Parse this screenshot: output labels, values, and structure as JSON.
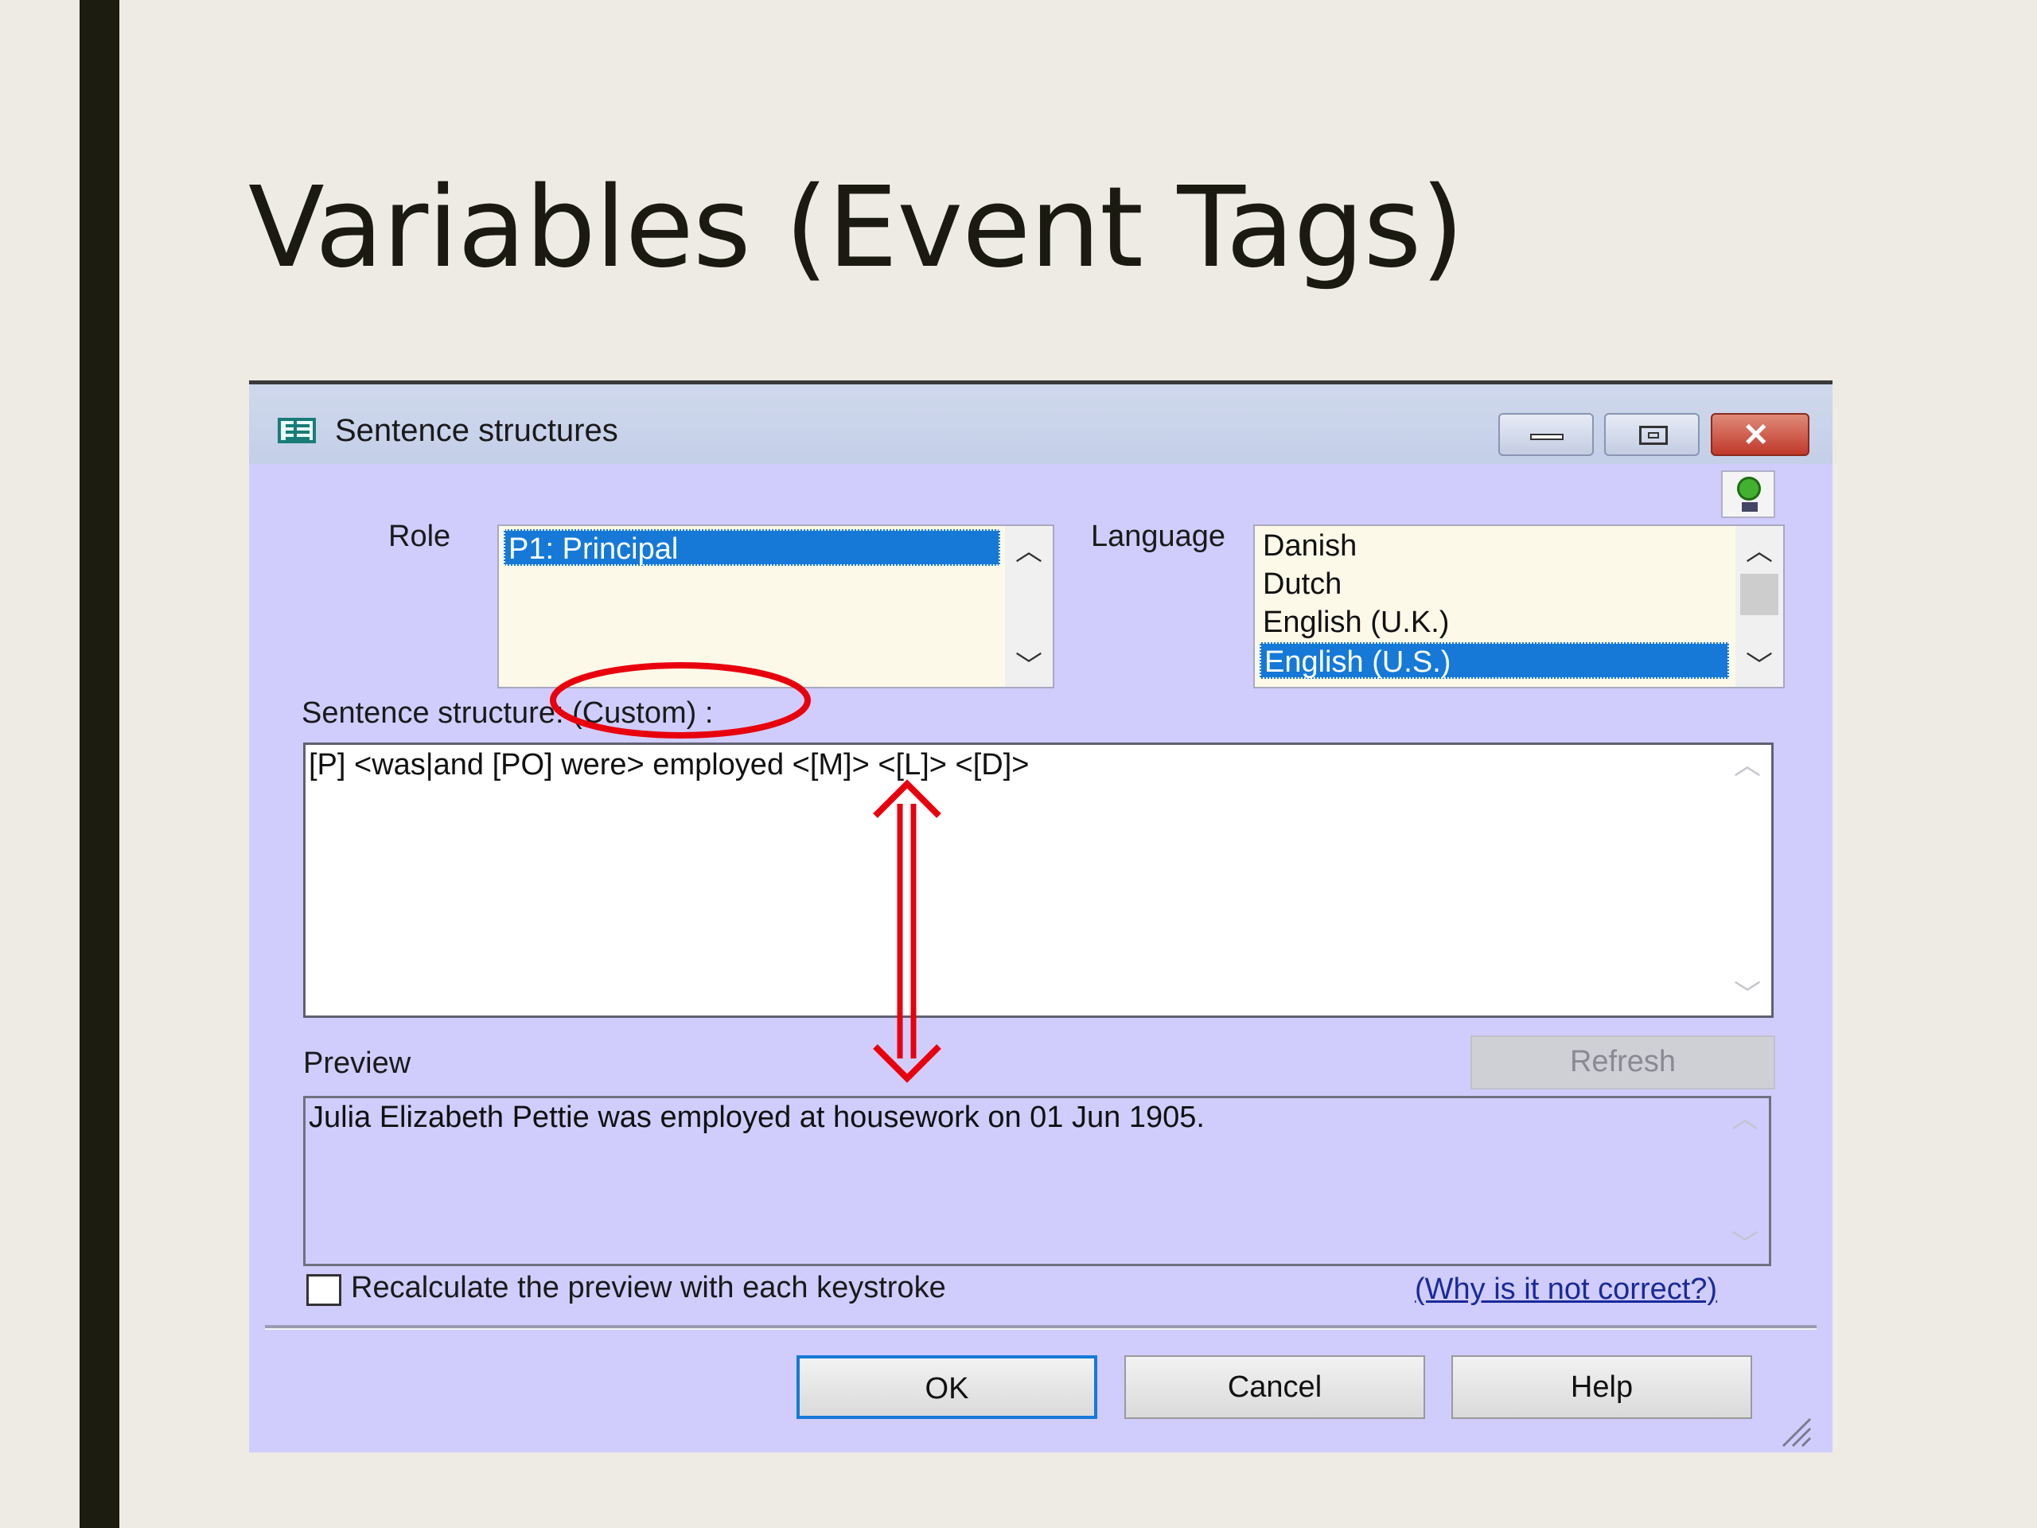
{
  "slide": {
    "title": "Variables (Event Tags)"
  },
  "dialog": {
    "title": "Sentence structures",
    "role_label": "Role",
    "role_items": [
      "P1: Principal"
    ],
    "role_selected": 0,
    "language_label": "Language",
    "language_items": [
      "Danish",
      "Dutch",
      "English (U.K.)",
      "English (U.S.)"
    ],
    "language_selected": 3,
    "structure_label": "Sentence structure: (Custom) :",
    "structure_value": "[P] <was|and [PO] were> employed <[M]> <[L]> <[D]>",
    "preview_label": "Preview",
    "refresh_label": "Refresh",
    "preview_value": "Julia Elizabeth Pettie was employed at housework on 01 Jun 1905.",
    "recalc_label": "Recalculate the preview with each keystroke",
    "recalc_checked": false,
    "why_link": "(Why is it not correct?)",
    "ok_label": "OK",
    "cancel_label": "Cancel",
    "help_label": "Help"
  },
  "colors": {
    "dialog_bg": "#d0cdfd",
    "selection": "#1679d8",
    "annotation": "#e8000d",
    "close_button": "#c0392b"
  },
  "icons": [
    "sentence-structures-app-icon",
    "minimize-icon",
    "maximize-icon",
    "close-icon",
    "lightbulb-icon",
    "chevron-up-icon",
    "chevron-down-icon",
    "resize-grip-icon"
  ]
}
